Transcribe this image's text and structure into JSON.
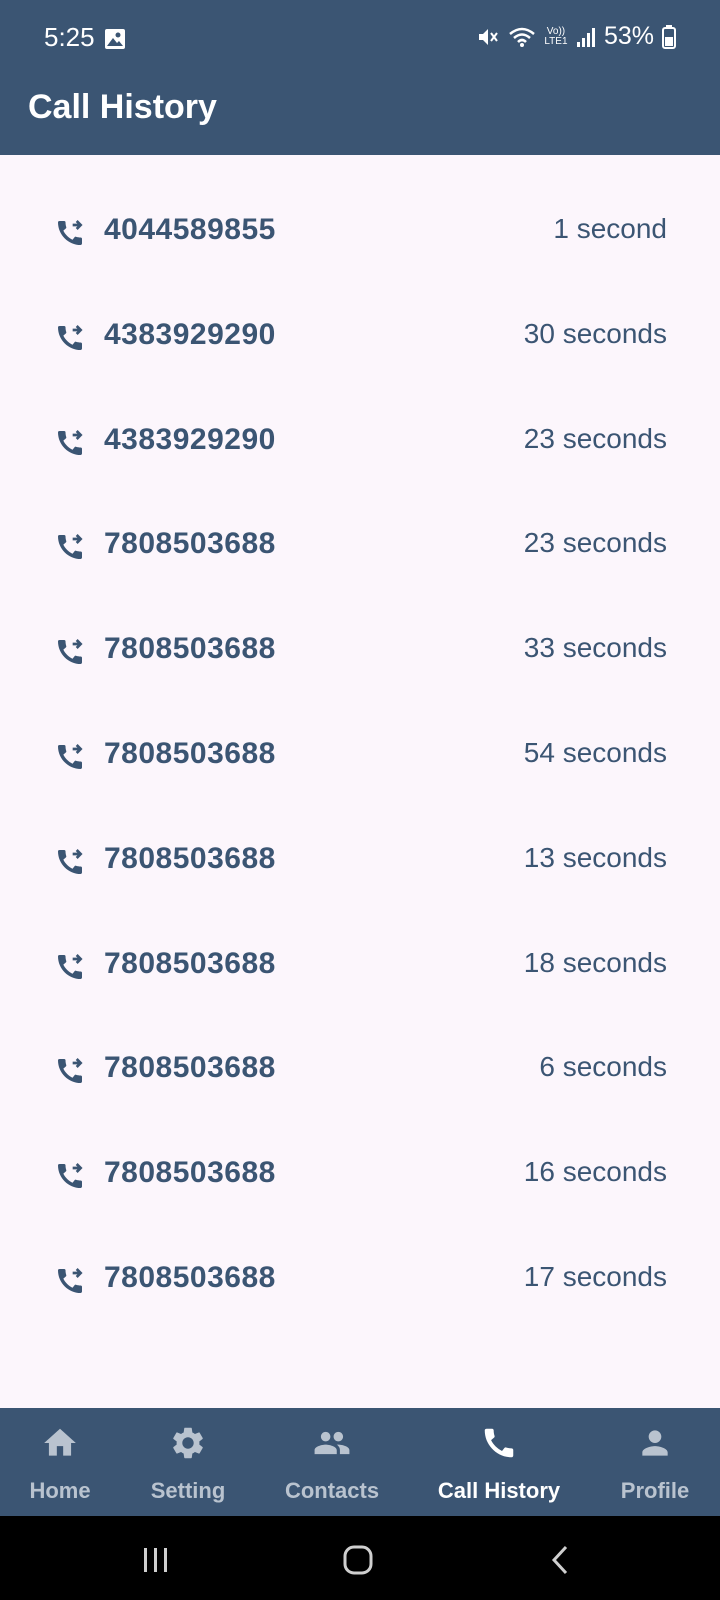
{
  "status_bar": {
    "time": "5:25",
    "battery": "53%",
    "network_label": "Vo)) LTE1"
  },
  "app_bar": {
    "title": "Call History"
  },
  "calls": [
    {
      "number": "4044589855",
      "duration": "1 second"
    },
    {
      "number": "4383929290",
      "duration": "30 seconds"
    },
    {
      "number": "4383929290",
      "duration": "23 seconds"
    },
    {
      "number": "7808503688",
      "duration": "23 seconds"
    },
    {
      "number": "7808503688",
      "duration": "33 seconds"
    },
    {
      "number": "7808503688",
      "duration": "54 seconds"
    },
    {
      "number": "7808503688",
      "duration": "13 seconds"
    },
    {
      "number": "7808503688",
      "duration": "18 seconds"
    },
    {
      "number": "7808503688",
      "duration": "6 seconds"
    },
    {
      "number": "7808503688",
      "duration": "16 seconds"
    },
    {
      "number": "7808503688",
      "duration": "17 seconds"
    }
  ],
  "bottom_nav": [
    {
      "label": "Home",
      "icon": "home-icon",
      "active": false
    },
    {
      "label": "Setting",
      "icon": "gear-icon",
      "active": false
    },
    {
      "label": "Contacts",
      "icon": "group-icon",
      "active": false
    },
    {
      "label": "Call History",
      "icon": "phone-icon",
      "active": true
    },
    {
      "label": "Profile",
      "icon": "person-icon",
      "active": false
    }
  ],
  "colors": {
    "primary": "#3b5573",
    "background": "#fcf6fc",
    "nav_inactive": "#b9c3cf",
    "nav_active": "#ffffff"
  }
}
